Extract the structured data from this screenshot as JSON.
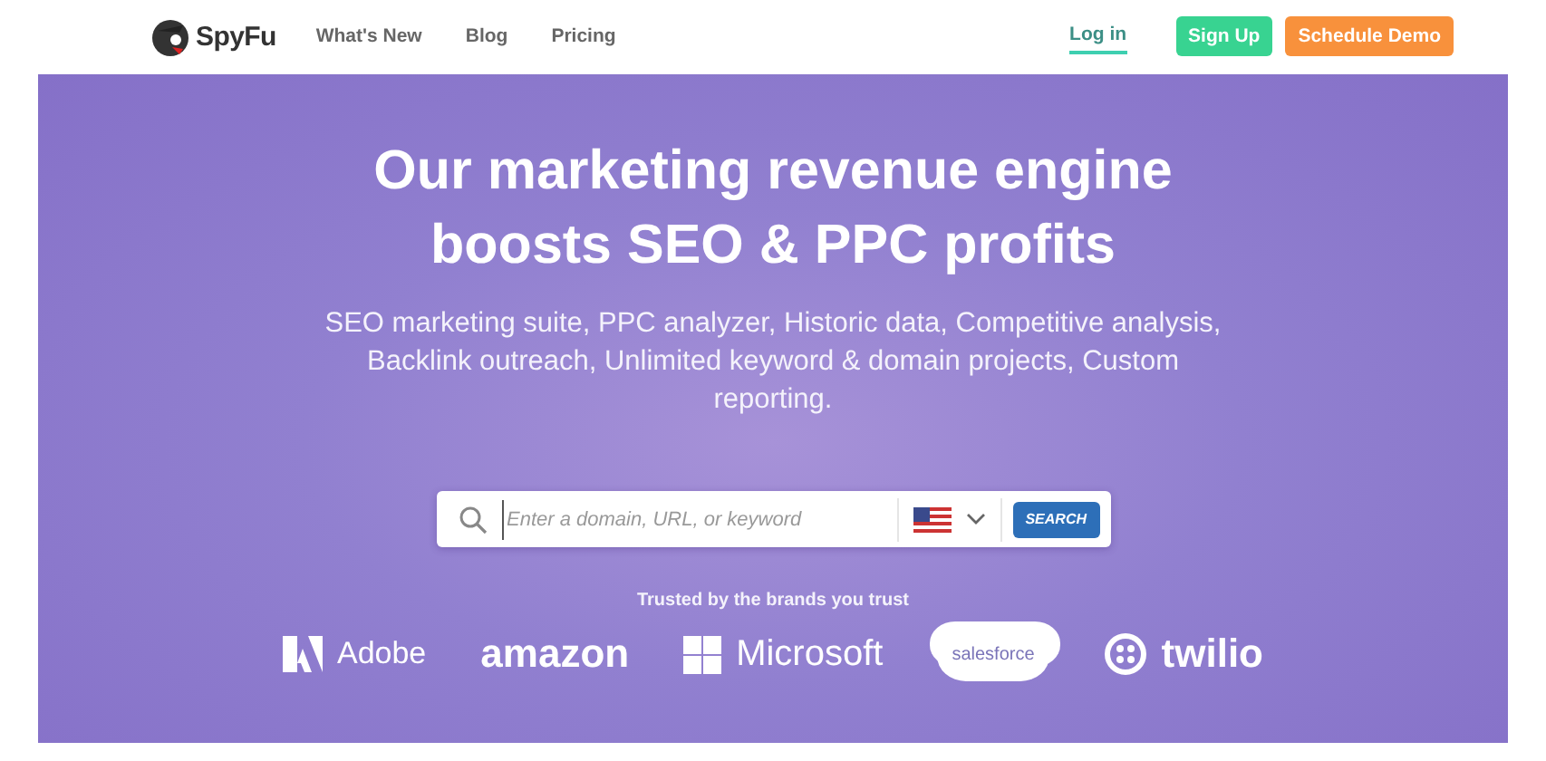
{
  "header": {
    "logo": "SpyFu",
    "nav": [
      {
        "label": "What's New",
        "selected": false
      },
      {
        "label": "Blog",
        "selected": false
      },
      {
        "label": "Pricing",
        "selected": false
      }
    ],
    "login": {
      "label": "Log in",
      "selected": true
    },
    "buttons": [
      {
        "label": "Sign Up",
        "kind": "signup"
      },
      {
        "label": "Schedule Demo",
        "kind": "demo"
      }
    ]
  },
  "hero": {
    "title": [
      "Our marketing revenue engine",
      "boosts SEO & PPC profits"
    ],
    "subtitle": "SEO marketing suite, PPC analyzer, Historic data, Competitive analysis, Backlink outreach, Unlimited keyword & domain projects, Custom reporting.",
    "search": {
      "placeholder": "Enter a domain, URL, or keyword",
      "button": "SEARCH"
    }
  },
  "brands": {
    "heading": "Trusted by the brands you trust",
    "items": [
      {
        "name": "Adobe",
        "kind": "adobe"
      },
      {
        "name": "amazon",
        "kind": "amazon"
      },
      {
        "name": "Microsoft",
        "kind": "microsoft"
      },
      {
        "name": "salesforce",
        "kind": "salesforce"
      },
      {
        "name": "twilio",
        "kind": "twilio"
      }
    ]
  }
}
